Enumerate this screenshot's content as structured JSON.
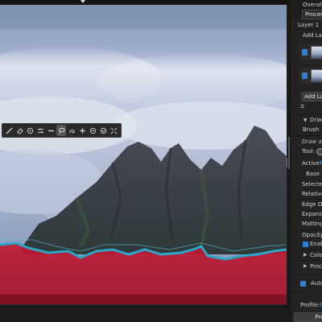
{
  "toolbar": {
    "tools": [
      "brush-tool",
      "eraser-tool",
      "target-tool",
      "sliders-tool",
      "minus-tool",
      "lasso-tool",
      "refine-tool",
      "add-tool",
      "subtract-tool",
      "check-tool",
      "fit-tool"
    ],
    "active_tool": "lasso-tool"
  },
  "panel": {
    "overall": "Overall I",
    "process": "Process",
    "layer1": "Layer 1",
    "add_layer_top": "Add Laye",
    "add_layer": "Add Laye",
    "draw": "Draw",
    "brush": "Brush",
    "draw_hint": "Draw a p",
    "tool": "Tool:",
    "active": "Active:",
    "active_value": "F",
    "base": "Base M",
    "selected": "Selected",
    "relative": "Relative W",
    "edge": "Edge Opti",
    "expand": "Expand",
    "matting": "Matting",
    "opacity": "Opacity",
    "enable": "Enable",
    "color": "Color",
    "proc": "Proc",
    "auto": "Auto",
    "profile": "Profile:",
    "profile_value": "S",
    "pre": "Pre"
  },
  "colors": {
    "selection_fill": "#c0102a",
    "selection_edge": "#2aa7c9",
    "accent": "#2f7fd4"
  }
}
